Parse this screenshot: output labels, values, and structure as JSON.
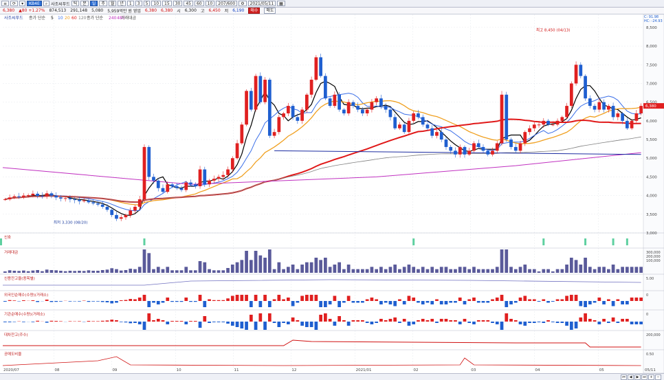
{
  "toolbar": {
    "items": [
      "≡",
      "⟳",
      "▾"
    ],
    "code": "KB4E",
    "find_icon": "search-icon",
    "chart_type_label": "사조씨푸드",
    "period_buttons": [
      "틱",
      "분",
      "일",
      "주",
      "월",
      "년"
    ],
    "minute_buttons": [
      "1",
      "3",
      "5",
      "10",
      "15",
      "30",
      "45",
      "60"
    ],
    "count_label": "10",
    "range": "207/600",
    "date": "2021/05/11"
  },
  "quote": {
    "price": "6,380",
    "change": "▲80 +1.27%",
    "volume": "874,513",
    "amount": "291,148",
    "prev": "5,080",
    "note": "5,959억만 원 영업",
    "open_label": "시",
    "open": "6,300",
    "high_label": "고",
    "high": "6,450",
    "low_label": "저",
    "low": "6,190",
    "buy_label": "매수",
    "sell_label": "매도"
  },
  "legend": {
    "main": "사조씨푸드",
    "ma_label": "종가 단순",
    "ma_items": [
      "5",
      "10",
      "20",
      "60",
      "120"
    ],
    "ma2_label": "종가 단순",
    "ma2_items": [
      "240",
      "480"
    ],
    "vol_label": "거래대금"
  },
  "panels": {
    "signal": "신호",
    "volume": "거래대금",
    "credit": "신용잔고율(종목별)",
    "foreign": "외국인순매수(수량)(거래소)",
    "institution": "기관순매수(수량)(거래소)",
    "short": "대차잔고(주수)",
    "short_ratio": "공매도비율"
  },
  "annotations": {
    "high": "최고 8,450 (04/13)",
    "low": "최저 3,330 (08/20)"
  },
  "colors": {
    "up": "#e02020",
    "down": "#1f5fd0",
    "ma5": "#000000",
    "ma10": "#3a6ee8",
    "ma20": "#f0a020",
    "ma60": "#e01818",
    "ma120": "#808080",
    "ma240": "#c030c0",
    "hline": "#1a2aa0"
  },
  "chart_data": {
    "type": "candlestick",
    "y_axis_ticks": [
      "8,500",
      "8,000",
      "7,500",
      "7,000",
      "6,500",
      "6,000",
      "5,500",
      "5,000",
      "4,500",
      "4,000",
      "3,500",
      "3,000"
    ],
    "ylim": [
      3000,
      8700
    ],
    "x_tick_labels": [
      "2020/07",
      "08",
      "09",
      "10",
      "11",
      "12",
      "2021/01",
      "02",
      "03",
      "04",
      "05",
      "05/11"
    ],
    "current_price_label": "6,380",
    "right_corner_labels": [
      "C: 91.98",
      "HC: -24.93"
    ],
    "closes": [
      3900,
      3950,
      3980,
      3960,
      4000,
      4010,
      4050,
      3990,
      3980,
      4060,
      4000,
      3950,
      3920,
      3930,
      3900,
      3880,
      3850,
      3870,
      3820,
      3790,
      3760,
      3700,
      3620,
      3480,
      3380,
      3420,
      3480,
      3600,
      3700,
      3900,
      5300,
      4500,
      4400,
      4200,
      4100,
      4300,
      4250,
      4200,
      4150,
      4350,
      4300,
      4250,
      4700,
      4300,
      4400,
      4450,
      4500,
      4550,
      4700,
      5000,
      5400,
      5900,
      6800,
      6300,
      7200,
      6500,
      7100,
      5600,
      5700,
      6100,
      6200,
      6400,
      6100,
      6000,
      6300,
      6700,
      7100,
      7700,
      7200,
      6600,
      6400,
      6700,
      6300,
      6200,
      6500,
      6400,
      6300,
      6200,
      6300,
      6500,
      6600,
      6400,
      6300,
      6100,
      5800,
      5900,
      5700,
      6000,
      6200,
      6100,
      5900,
      5800,
      5600,
      5700,
      5500,
      5300,
      5200,
      5100,
      5300,
      5100,
      5200,
      5400,
      5300,
      5200,
      5100,
      5200,
      5400,
      6700,
      5500,
      5300,
      5200,
      5400,
      5700,
      5800,
      5900,
      5900,
      6000,
      5900,
      5900,
      6000,
      6100,
      6400,
      7000,
      7500,
      7200,
      6600,
      6400,
      6300,
      6500,
      6300,
      6400,
      6100,
      6200,
      6000,
      5800,
      6000,
      6200,
      6400
    ],
    "volume_peak_label": "300,000",
    "volume_ticks": [
      "300,000",
      "200,000",
      "100,000"
    ],
    "credit_ticks": [
      "5.00"
    ],
    "foreign_ticks": [
      "0"
    ],
    "inst_ticks": [
      "0"
    ],
    "short_ticks": [
      "200,000"
    ],
    "short_ratio_ticks": [
      "0.50"
    ]
  }
}
